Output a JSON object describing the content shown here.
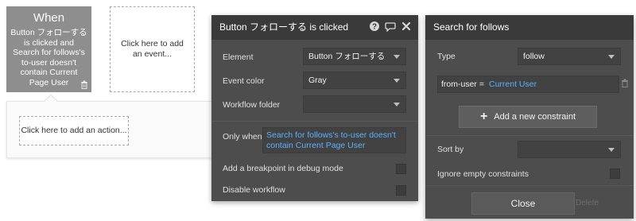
{
  "event_card": {
    "title": "When",
    "description": "Button フォローする is clicked and Search for follows's to-user doesn't contain Current Page User"
  },
  "add_event": {
    "label": "Click here to add an event..."
  },
  "add_action": {
    "label": "Click here to add an action..."
  },
  "workflow_panel": {
    "title": "Button フォローする is clicked",
    "element_label": "Element",
    "element_value": "Button フォローする",
    "event_color_label": "Event color",
    "event_color_value": "Gray",
    "workflow_folder_label": "Workflow folder",
    "workflow_folder_value": "",
    "only_when_label": "Only when",
    "only_when_value": "Search for follows's to-user doesn't contain Current Page User",
    "breakpoint_label": "Add a breakpoint in debug mode",
    "disable_label": "Disable workflow"
  },
  "search_panel": {
    "title": "Search for follows",
    "type_label": "Type",
    "type_value": "follow",
    "constraint_field": "from-user =",
    "constraint_value": "Current User",
    "add_constraint_label": "Add a new constraint",
    "sort_by_label": "Sort by",
    "sort_by_value": "",
    "ignore_empty_label": "Ignore empty constraints",
    "close_label": "Close",
    "delete_label": "Delete"
  },
  "colors": {
    "event_card_bg": "#8e8e8e",
    "panel_bg": "#4d4d4d",
    "panel_header_bg": "#3a3a3a",
    "dynamic_text": "#5db0ff"
  },
  "icons": [
    "trash-icon",
    "help-icon",
    "comment-icon",
    "close-icon",
    "plus-icon",
    "chevron-down-icon"
  ]
}
